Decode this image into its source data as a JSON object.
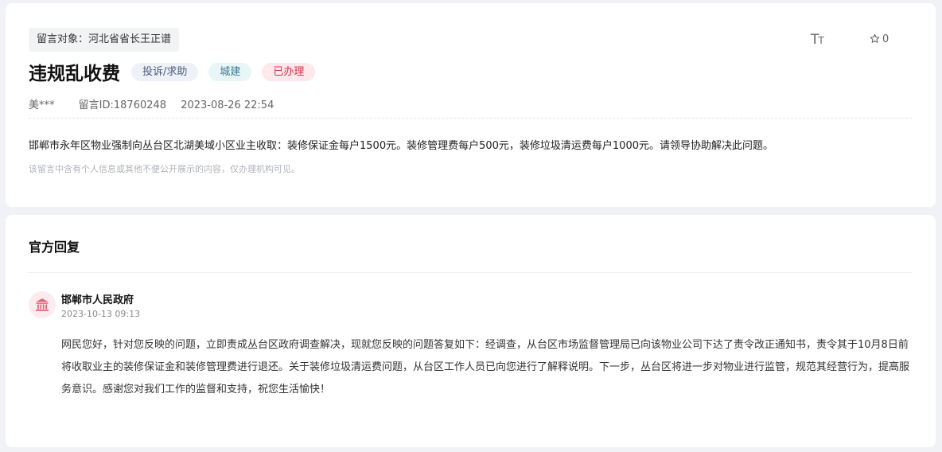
{
  "message": {
    "target": "留言对象：河北省省长王正谱",
    "font_toggle_label": "Tт",
    "favorite_count": "0",
    "title": "违规乱收费",
    "tags": {
      "category": "投诉/求助",
      "department": "城建",
      "status": "已办理"
    },
    "author": "美***",
    "message_id": "留言ID:18760248",
    "timestamp": "2023-08-26 22:54",
    "content": "邯郸市永年区物业强制向丛台区北湖美域小区业主收取：装修保证金每户1500元。装修管理费每户500元，装修垃圾清运费每户1000元。请领导协助解决此问题。",
    "privacy_notice": "该留言中含有个人信息或其他不便公开展示的内容，仅办理机构可见。"
  },
  "reply": {
    "heading": "官方回复",
    "responder": "邯郸市人民政府",
    "timestamp": "2023-10-13 09:13",
    "body": "网民您好，针对您反映的问题，立即责成丛台区政府调查解决，现就您反映的问题答复如下：经调查，从台区市场监督管理局已向该物业公司下达了责令改正通知书，责令其于10月8日前将收取业主的装修保证金和装修管理费进行退还。关于装修垃圾清运费问题，从台区工作人员已向您进行了解释说明。下一步，丛台区将进一步对物业进行监管，规范其经营行为，提高服务意识。感谢您对我们工作的监督和支持，祝您生活愉快！"
  },
  "colors": {
    "page_bg": "#f1f2f5",
    "status_tag_text": "#d9304b",
    "status_tag_bg": "#fde9ec",
    "gov_icon": "#e0667a"
  },
  "icons": {
    "font_size": "font-size-icon",
    "favorite": "star-icon",
    "government": "government-building-icon"
  }
}
